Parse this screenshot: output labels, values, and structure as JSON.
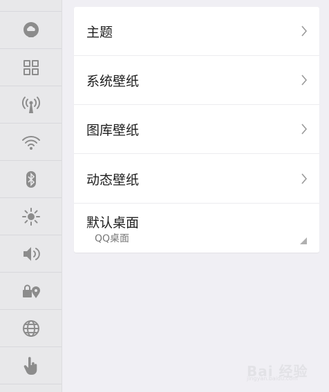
{
  "sidebar": {
    "items": [
      {
        "icon": "display-icon"
      },
      {
        "icon": "cloud-chat-icon"
      },
      {
        "icon": "grid-apps-icon"
      },
      {
        "icon": "hotspot-antenna-icon"
      },
      {
        "icon": "wifi-icon"
      },
      {
        "icon": "bluetooth-icon"
      },
      {
        "icon": "brightness-icon"
      },
      {
        "icon": "volume-icon"
      },
      {
        "icon": "lock-location-icon"
      },
      {
        "icon": "globe-icon"
      },
      {
        "icon": "hand-pointer-icon"
      }
    ]
  },
  "settings": {
    "rows": [
      {
        "label": "主题"
      },
      {
        "label": "系统壁纸"
      },
      {
        "label": "图库壁纸"
      },
      {
        "label": "动态壁纸"
      },
      {
        "label": "默认桌面",
        "value": "QQ桌面"
      }
    ]
  },
  "watermark": {
    "text": "Bai 经验",
    "sub": "jingyan.baidu.com"
  },
  "colors": {
    "sidebar_bg": "#e8e8ea",
    "page_bg": "#f0eff4",
    "card_bg": "#ffffff",
    "icon": "#8c8c8c"
  }
}
